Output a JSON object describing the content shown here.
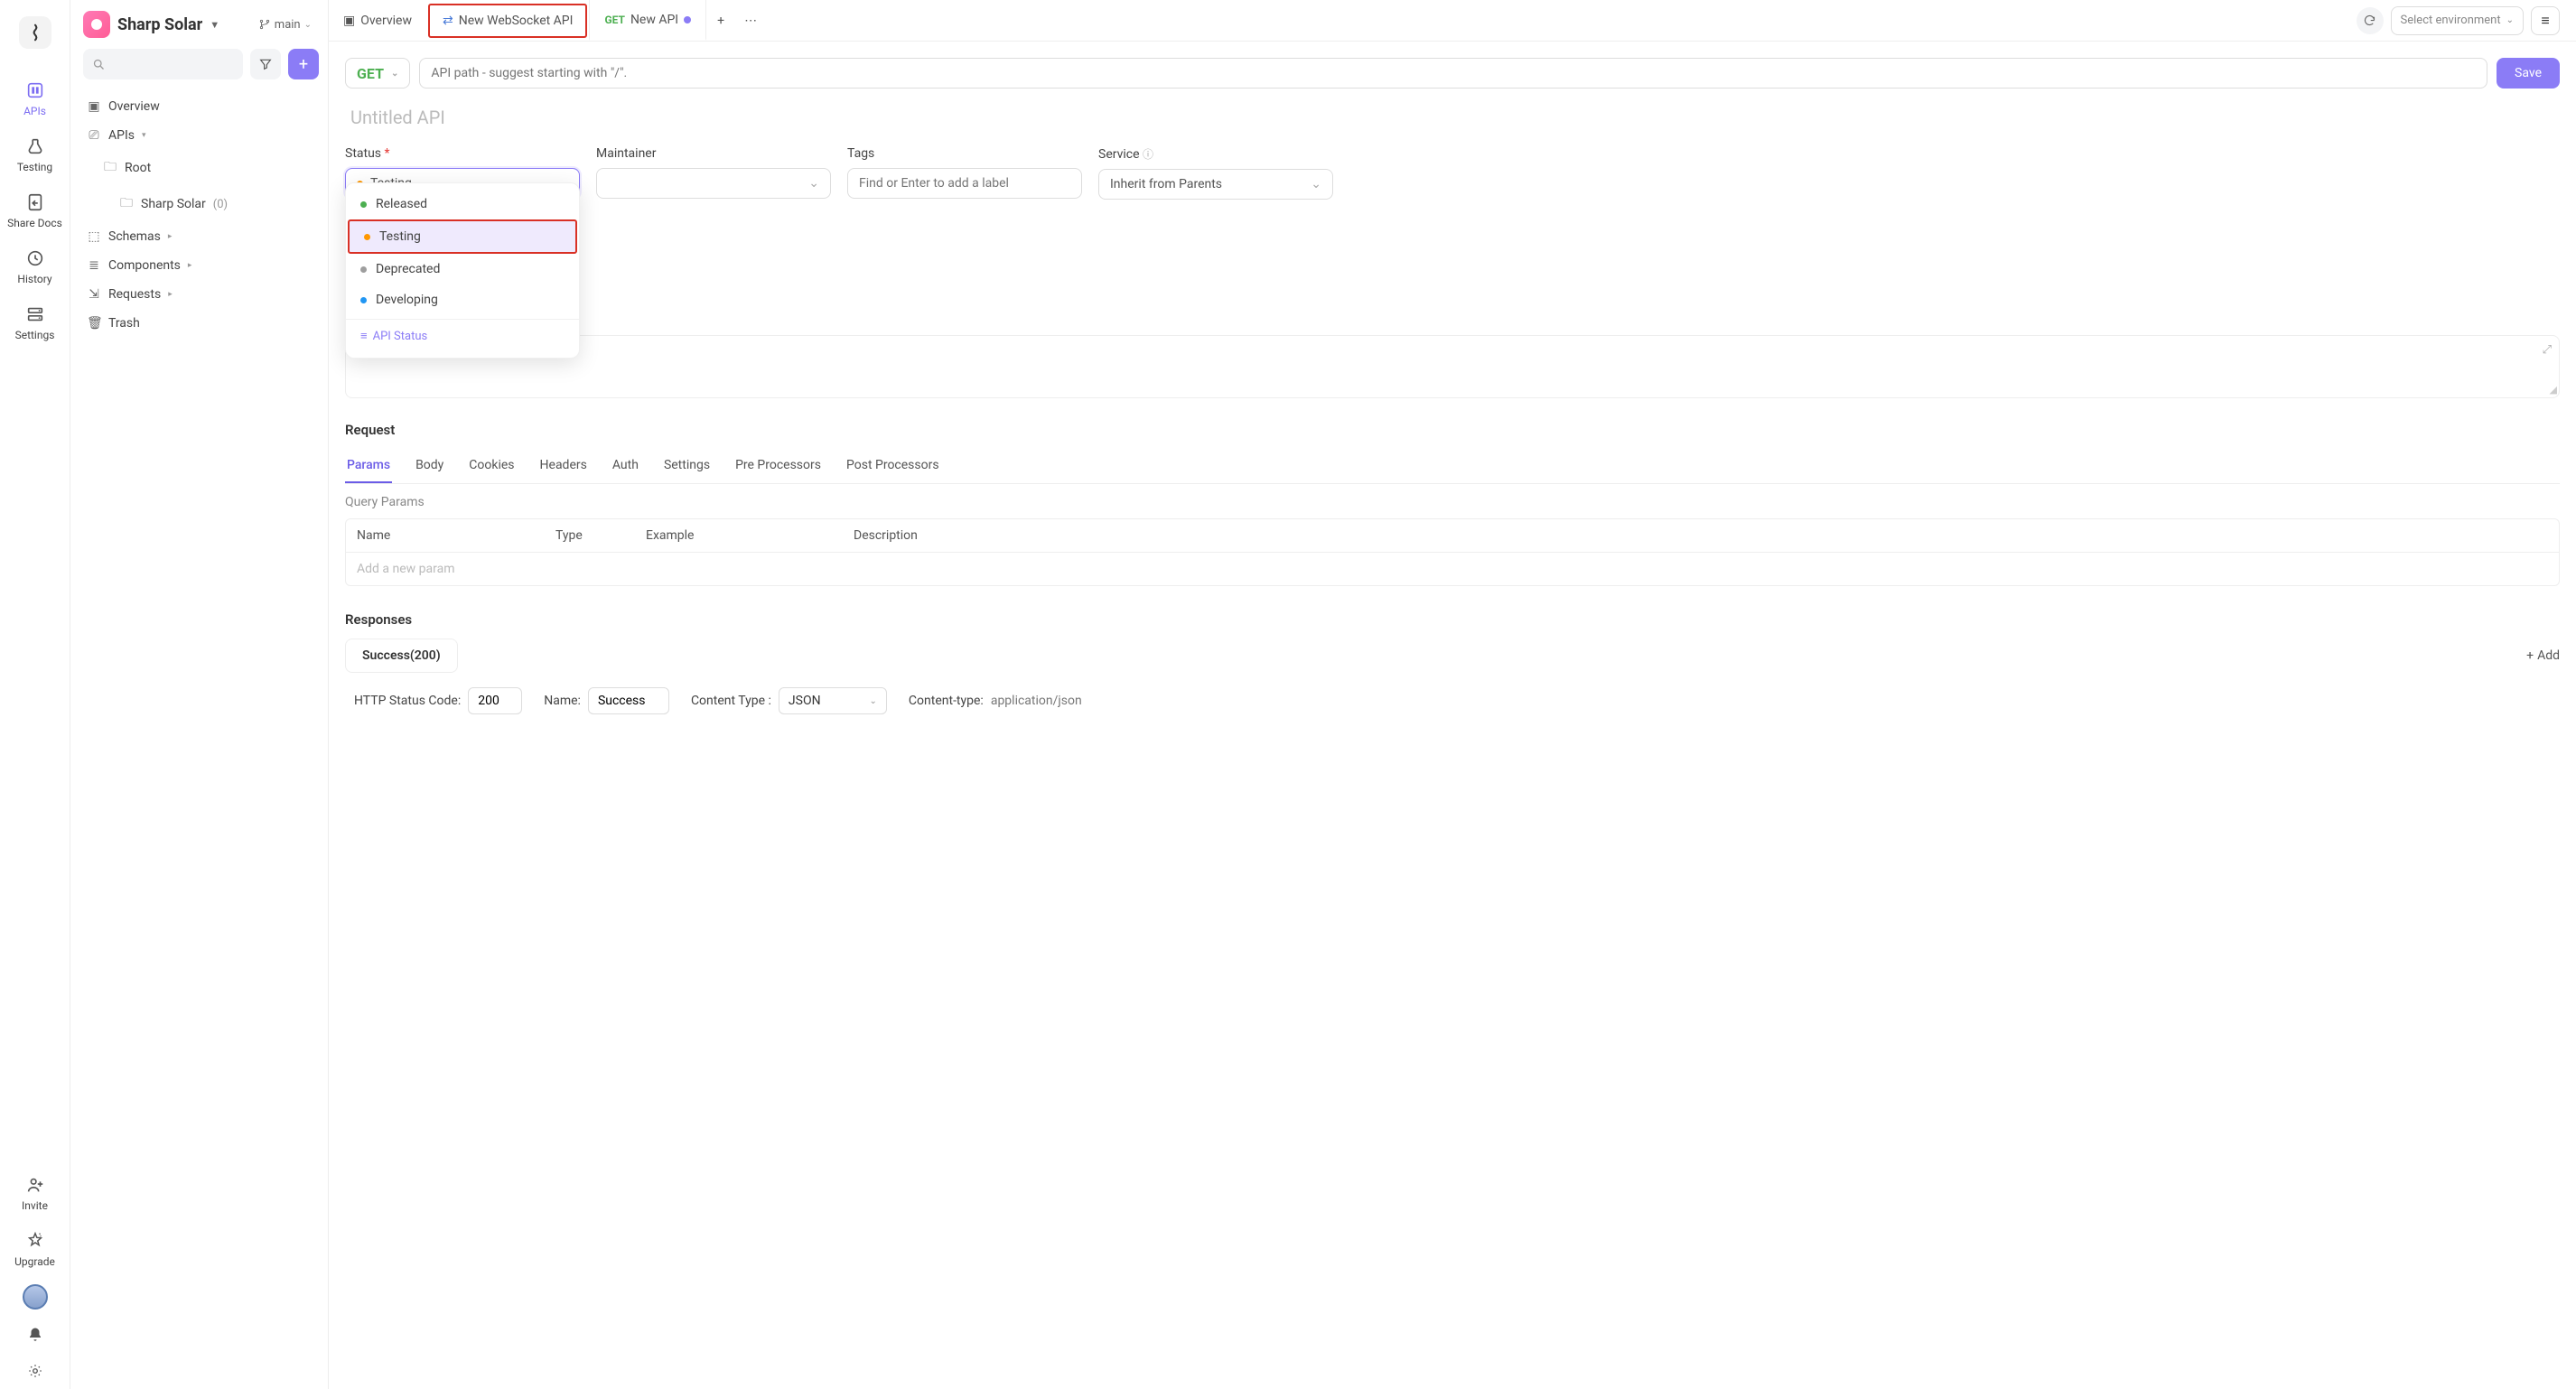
{
  "nav": {
    "items": [
      {
        "label": "APIs"
      },
      {
        "label": "Testing"
      },
      {
        "label": "Share Docs"
      },
      {
        "label": "History"
      },
      {
        "label": "Settings"
      }
    ],
    "invite": "Invite",
    "upgrade": "Upgrade"
  },
  "workspace": {
    "name": "Sharp Solar",
    "branch": "main"
  },
  "tree": {
    "overview": "Overview",
    "apis": "APIs",
    "root": "Root",
    "project": "Sharp Solar",
    "project_count": "(0)",
    "schemas": "Schemas",
    "components": "Components",
    "requests": "Requests",
    "trash": "Trash"
  },
  "tabs": {
    "t0": {
      "label": "Overview"
    },
    "t1": {
      "label": "New WebSocket API"
    },
    "t2": {
      "method": "GET",
      "label": "New API"
    },
    "env_placeholder": "Select environment"
  },
  "request": {
    "method": "GET",
    "path_placeholder": "API path - suggest starting with \"/\".",
    "save": "Save",
    "title_placeholder": "Untitled API"
  },
  "meta": {
    "status_label": "Status",
    "status_value": "Testing",
    "maintainer_label": "Maintainer",
    "tags_label": "Tags",
    "tags_placeholder": "Find or Enter to add a label",
    "service_label": "Service",
    "service_value": "Inherit from Parents"
  },
  "status_options": {
    "o0": "Released",
    "o1": "Testing",
    "o2": "Deprecated",
    "o3": "Developing",
    "footer": "API Status"
  },
  "req_section": {
    "title": "Request",
    "tabs": {
      "t0": "Params",
      "t1": "Body",
      "t2": "Cookies",
      "t3": "Headers",
      "t4": "Auth",
      "t5": "Settings",
      "t6": "Pre Processors",
      "t7": "Post Processors"
    },
    "query_label": "Query Params",
    "cols": {
      "name": "Name",
      "type": "Type",
      "example": "Example",
      "desc": "Description"
    },
    "add_placeholder": "Add a new param"
  },
  "resp_section": {
    "title": "Responses",
    "tab": "Success(200)",
    "add": "Add",
    "http_label": "HTTP Status Code:",
    "http_value": "200",
    "name_label": "Name:",
    "name_value": "Success",
    "ct_label": "Content Type :",
    "ct_value": "JSON",
    "ct2_label": "Content-type:",
    "ct2_value": "application/json"
  }
}
